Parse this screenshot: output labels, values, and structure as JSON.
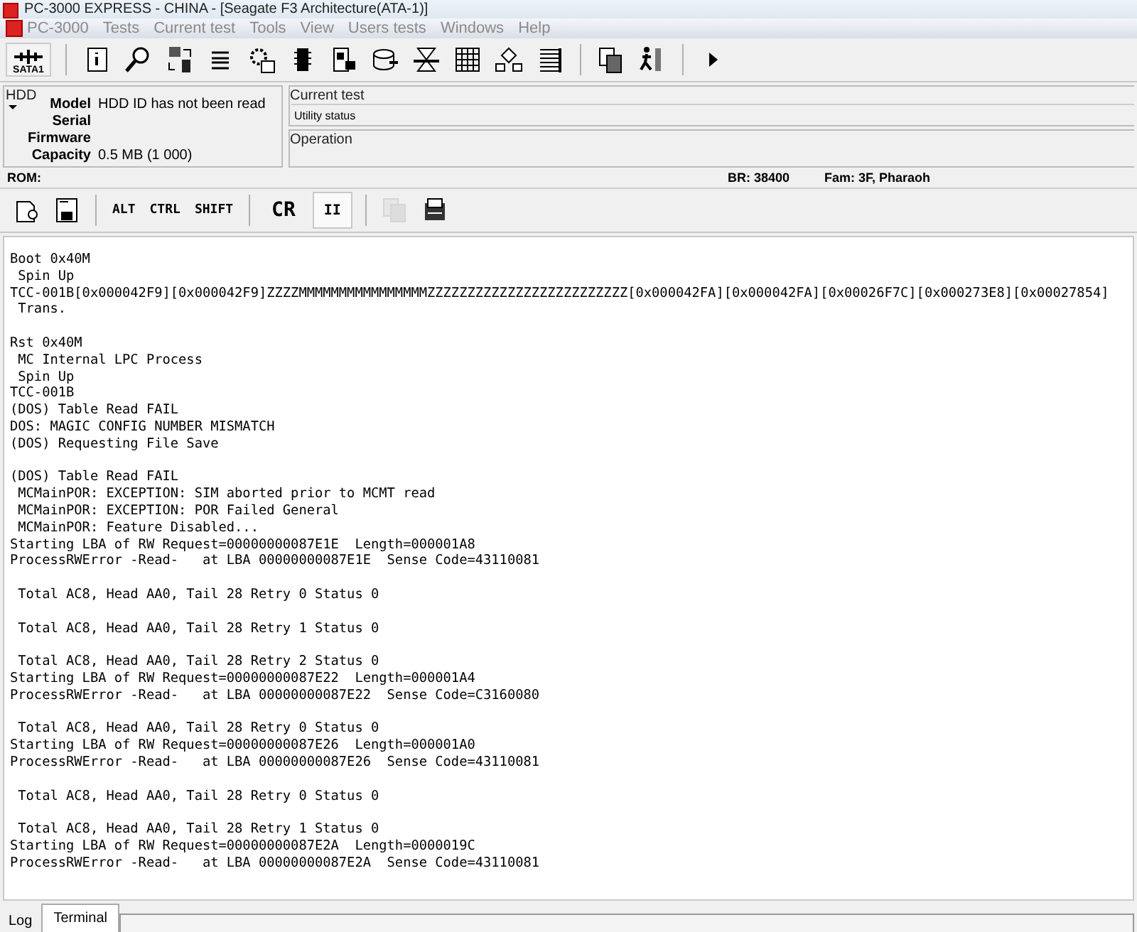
{
  "window": {
    "title": "PC-3000 EXPRESS - CHINA - [Seagate F3 Architecture(ATA-1)]"
  },
  "menu": [
    {
      "label": "PC-3000",
      "kind": "app"
    },
    {
      "label": "Tests",
      "kind": "plain"
    },
    {
      "label": "Current test",
      "kind": "plain"
    },
    {
      "label": "Tools",
      "kind": "plain"
    },
    {
      "label": "View",
      "kind": "plain"
    },
    {
      "label": "Users tests",
      "kind": "plain"
    },
    {
      "label": "Windows",
      "kind": "plain"
    },
    {
      "label": "Help",
      "kind": "plain"
    }
  ],
  "toolbar": [
    {
      "kind": "labeled",
      "label": "SATA1"
    },
    {
      "kind": "sep"
    },
    {
      "kind": "icon"
    },
    {
      "kind": "icon"
    },
    {
      "kind": "icon"
    },
    {
      "kind": "icon"
    },
    {
      "kind": "icon"
    },
    {
      "kind": "icon"
    },
    {
      "kind": "icon"
    },
    {
      "kind": "icon"
    },
    {
      "kind": "icon"
    },
    {
      "kind": "icon"
    },
    {
      "kind": "icon"
    },
    {
      "kind": "icon"
    },
    {
      "kind": "sep"
    },
    {
      "kind": "icon"
    },
    {
      "kind": "icon"
    },
    {
      "kind": "sep"
    },
    {
      "kind": "icon"
    }
  ],
  "hdd": {
    "title": "HDD",
    "fields": [
      {
        "label": "Model",
        "value": "HDD ID has not been read"
      },
      {
        "label": "Serial"
      },
      {
        "label": "Firmware"
      },
      {
        "label": "Capacity",
        "value": "0.5 MB (1 000)"
      }
    ]
  },
  "current_test": {
    "title": "Current test",
    "status": "Utility status"
  },
  "operation": {
    "title": "Operation"
  },
  "status_line": {
    "rom": "ROM:",
    "br": "BR: 38400",
    "fam": "Fam: 3F, Pharaoh"
  },
  "terminal_toolbar": [
    {
      "kind": "icon"
    },
    {
      "kind": "icon"
    },
    {
      "kind": "sep"
    },
    {
      "kind": "key",
      "label": "ALT"
    },
    {
      "kind": "key",
      "label": "CTRL"
    },
    {
      "kind": "key",
      "label": "SHIFT"
    },
    {
      "kind": "sep"
    },
    {
      "kind": "big",
      "label": "CR"
    },
    {
      "kind": "toggle",
      "label": "II",
      "pressed": true
    },
    {
      "kind": "sep"
    },
    {
      "kind": "icon",
      "disabled": true
    },
    {
      "kind": "icon",
      "disabled": false
    }
  ],
  "terminal": {
    "blocks": [
      [
        "Boot 0x40M",
        " Spin Up",
        "TCC-001B[0x000042F9][0x000042F9]ZZZZMMMMMMMMMMMMMMMMZZZZZZZZZZZZZZZZZZZZZZZZZ[0x000042FA][0x000042FA][0x00026F7C][0x000273E8][0x00027854]",
        " Trans."
      ],
      [
        "Rst 0x40M",
        " MC Internal LPC Process",
        " Spin Up",
        "TCC-001B",
        "(DOS) Table Read FAIL",
        "DOS: MAGIC CONFIG NUMBER MISMATCH",
        "(DOS) Requesting File Save"
      ],
      [
        "(DOS) Table Read FAIL",
        " MCMainPOR: EXCEPTION: SIM aborted prior to MCMT read",
        " MCMainPOR: EXCEPTION: POR Failed General",
        " MCMainPOR: Feature Disabled...",
        "Starting LBA of RW Request=00000000087E1E  Length=000001A8",
        "ProcessRWError -Read-   at LBA 00000000087E1E  Sense Code=43110081"
      ],
      [
        " Total AC8, Head AA0, Tail 28 Retry 0 Status 0"
      ],
      [
        " Total AC8, Head AA0, Tail 28 Retry 1 Status 0"
      ],
      [
        " Total AC8, Head AA0, Tail 28 Retry 2 Status 0",
        "Starting LBA of RW Request=00000000087E22  Length=000001A4",
        "ProcessRWError -Read-   at LBA 00000000087E22  Sense Code=C3160080"
      ],
      [
        " Total AC8, Head AA0, Tail 28 Retry 0 Status 0",
        "Starting LBA of RW Request=00000000087E26  Length=000001A0",
        "ProcessRWError -Read-   at LBA 00000000087E26  Sense Code=43110081"
      ],
      [
        " Total AC8, Head AA0, Tail 28 Retry 0 Status 0"
      ],
      [
        " Total AC8, Head AA0, Tail 28 Retry 1 Status 0",
        "Starting LBA of RW Request=00000000087E2A  Length=0000019C",
        "ProcessRWError -Read-   at LBA 00000000087E2A  Sense Code=43110081"
      ]
    ]
  },
  "tabs": [
    {
      "label": "Log",
      "selected": false
    },
    {
      "label": "Terminal",
      "selected": true
    }
  ]
}
